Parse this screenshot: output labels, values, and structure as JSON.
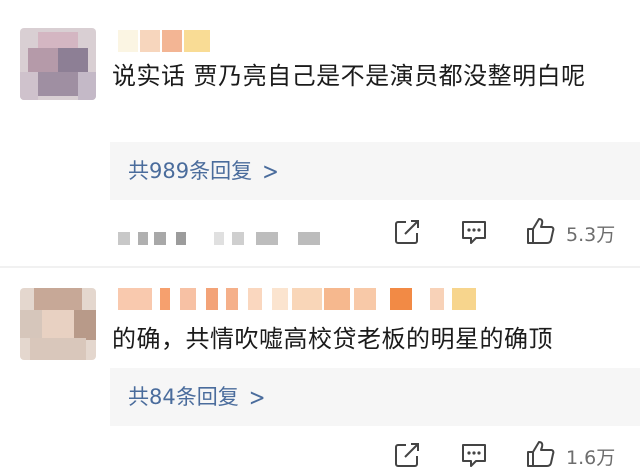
{
  "comments": [
    {
      "text": "说实话 贾乃亮自己是不是演员都没整明白呢",
      "reply_label": "共989条回复",
      "reply_chevron": ">",
      "likes": "5.3万"
    },
    {
      "text": "的确，共情吹嘘高校贷老板的明星的确顶",
      "reply_label": "共84条回复",
      "reply_chevron": ">",
      "likes": "1.6万"
    }
  ]
}
